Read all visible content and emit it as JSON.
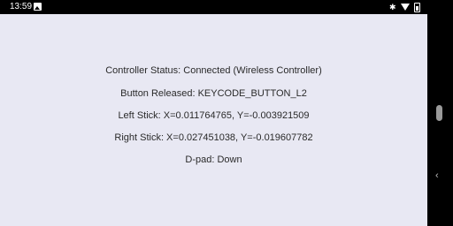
{
  "status_bar": {
    "time": "13:59",
    "icons": [
      "image-notification-icon",
      "bluetooth-icon",
      "wifi-icon",
      "battery-icon"
    ]
  },
  "content": {
    "controller_status": "Controller Status: Connected (Wireless Controller)",
    "button_event": "Button Released: KEYCODE_BUTTON_L2",
    "left_stick": "Left Stick: X=0.011764765, Y=-0.003921509",
    "right_stick": "Right Stick: X=0.027451038, Y=-0.019607782",
    "dpad": "D-pad: Down"
  },
  "nav_bar": {
    "back_glyph": "‹",
    "icons": [
      "nav-handle-icon",
      "back-icon"
    ]
  },
  "colors": {
    "background": "#e8e8f3",
    "text": "#2a2a2a",
    "bars": "#000000"
  }
}
